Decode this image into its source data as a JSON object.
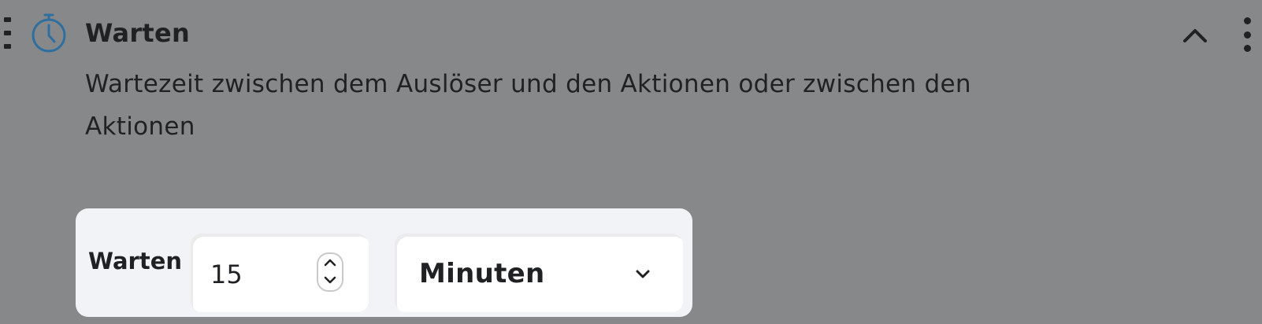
{
  "block": {
    "icon": "timer-icon",
    "title": "Warten",
    "description": "Wartezeit zwischen dem Auslöser und den Aktionen oder zwischen den Aktionen"
  },
  "form": {
    "label": "Warten",
    "amount": "15",
    "unit": "Minuten"
  },
  "colors": {
    "overlay_background": "#87888a",
    "panel_background": "#f2f3f6",
    "icon_accent": "#2f6f9f",
    "text": "#1f2123"
  }
}
